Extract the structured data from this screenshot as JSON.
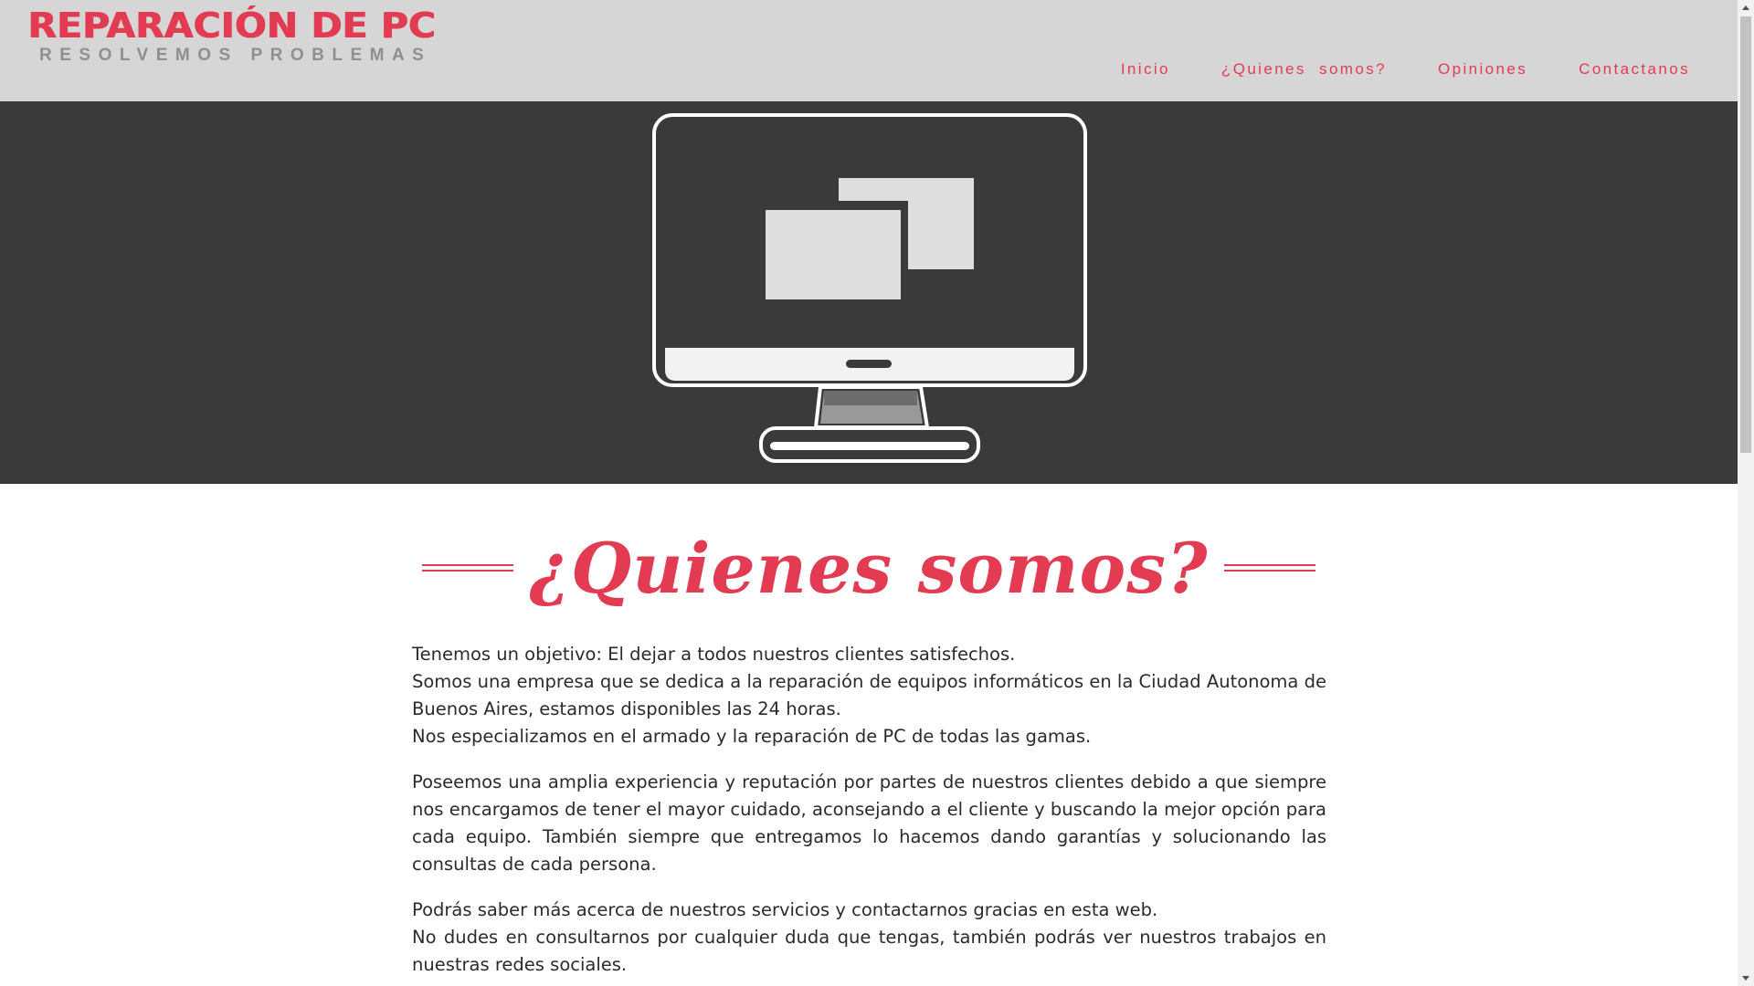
{
  "brand": {
    "title": "REPARACIÓN DE PC",
    "subtitle": "RESOLVEMOS PROBLEMAS"
  },
  "nav": {
    "items": [
      {
        "label": "Inicio"
      },
      {
        "label": "¿Quienes  somos?"
      },
      {
        "label": "Opiniones"
      },
      {
        "label": "Contactanos"
      }
    ]
  },
  "hero": {
    "icon": "desktop-monitor-windows-icon"
  },
  "section": {
    "heading": "¿Quienes somos?",
    "paragraphs": [
      [
        "Tenemos un objetivo: El dejar a todos nuestros clientes satisfechos.",
        "Somos una empresa que se dedica a la reparación de equipos informáticos en la Ciudad Autonoma de Buenos Aires, estamos disponibles las 24 horas.",
        "Nos especializamos en el armado y la reparación de PC de todas las gamas."
      ],
      [
        "Poseemos una amplia experiencia y reputación por partes de nuestros clientes debido a que siempre nos encargamos de tener el mayor cuidado, aconsejando a el cliente y buscando la mejor opción para cada equipo. También siempre que entregamos lo hacemos dando garantías y solucionando las consultas de cada persona."
      ],
      [
        "Podrás saber más acerca de nuestros servicios y contactarnos gracias en esta web.",
        "No dudes en consultarnos por cualquier duda que tengas, también podrás ver nuestros trabajos en nuestras redes sociales."
      ]
    ]
  },
  "colors": {
    "accent": "#e23b52",
    "header_bg": "#d6d6d6",
    "hero_bg": "#3a3a3a",
    "subtitle": "#8f8f8f"
  }
}
